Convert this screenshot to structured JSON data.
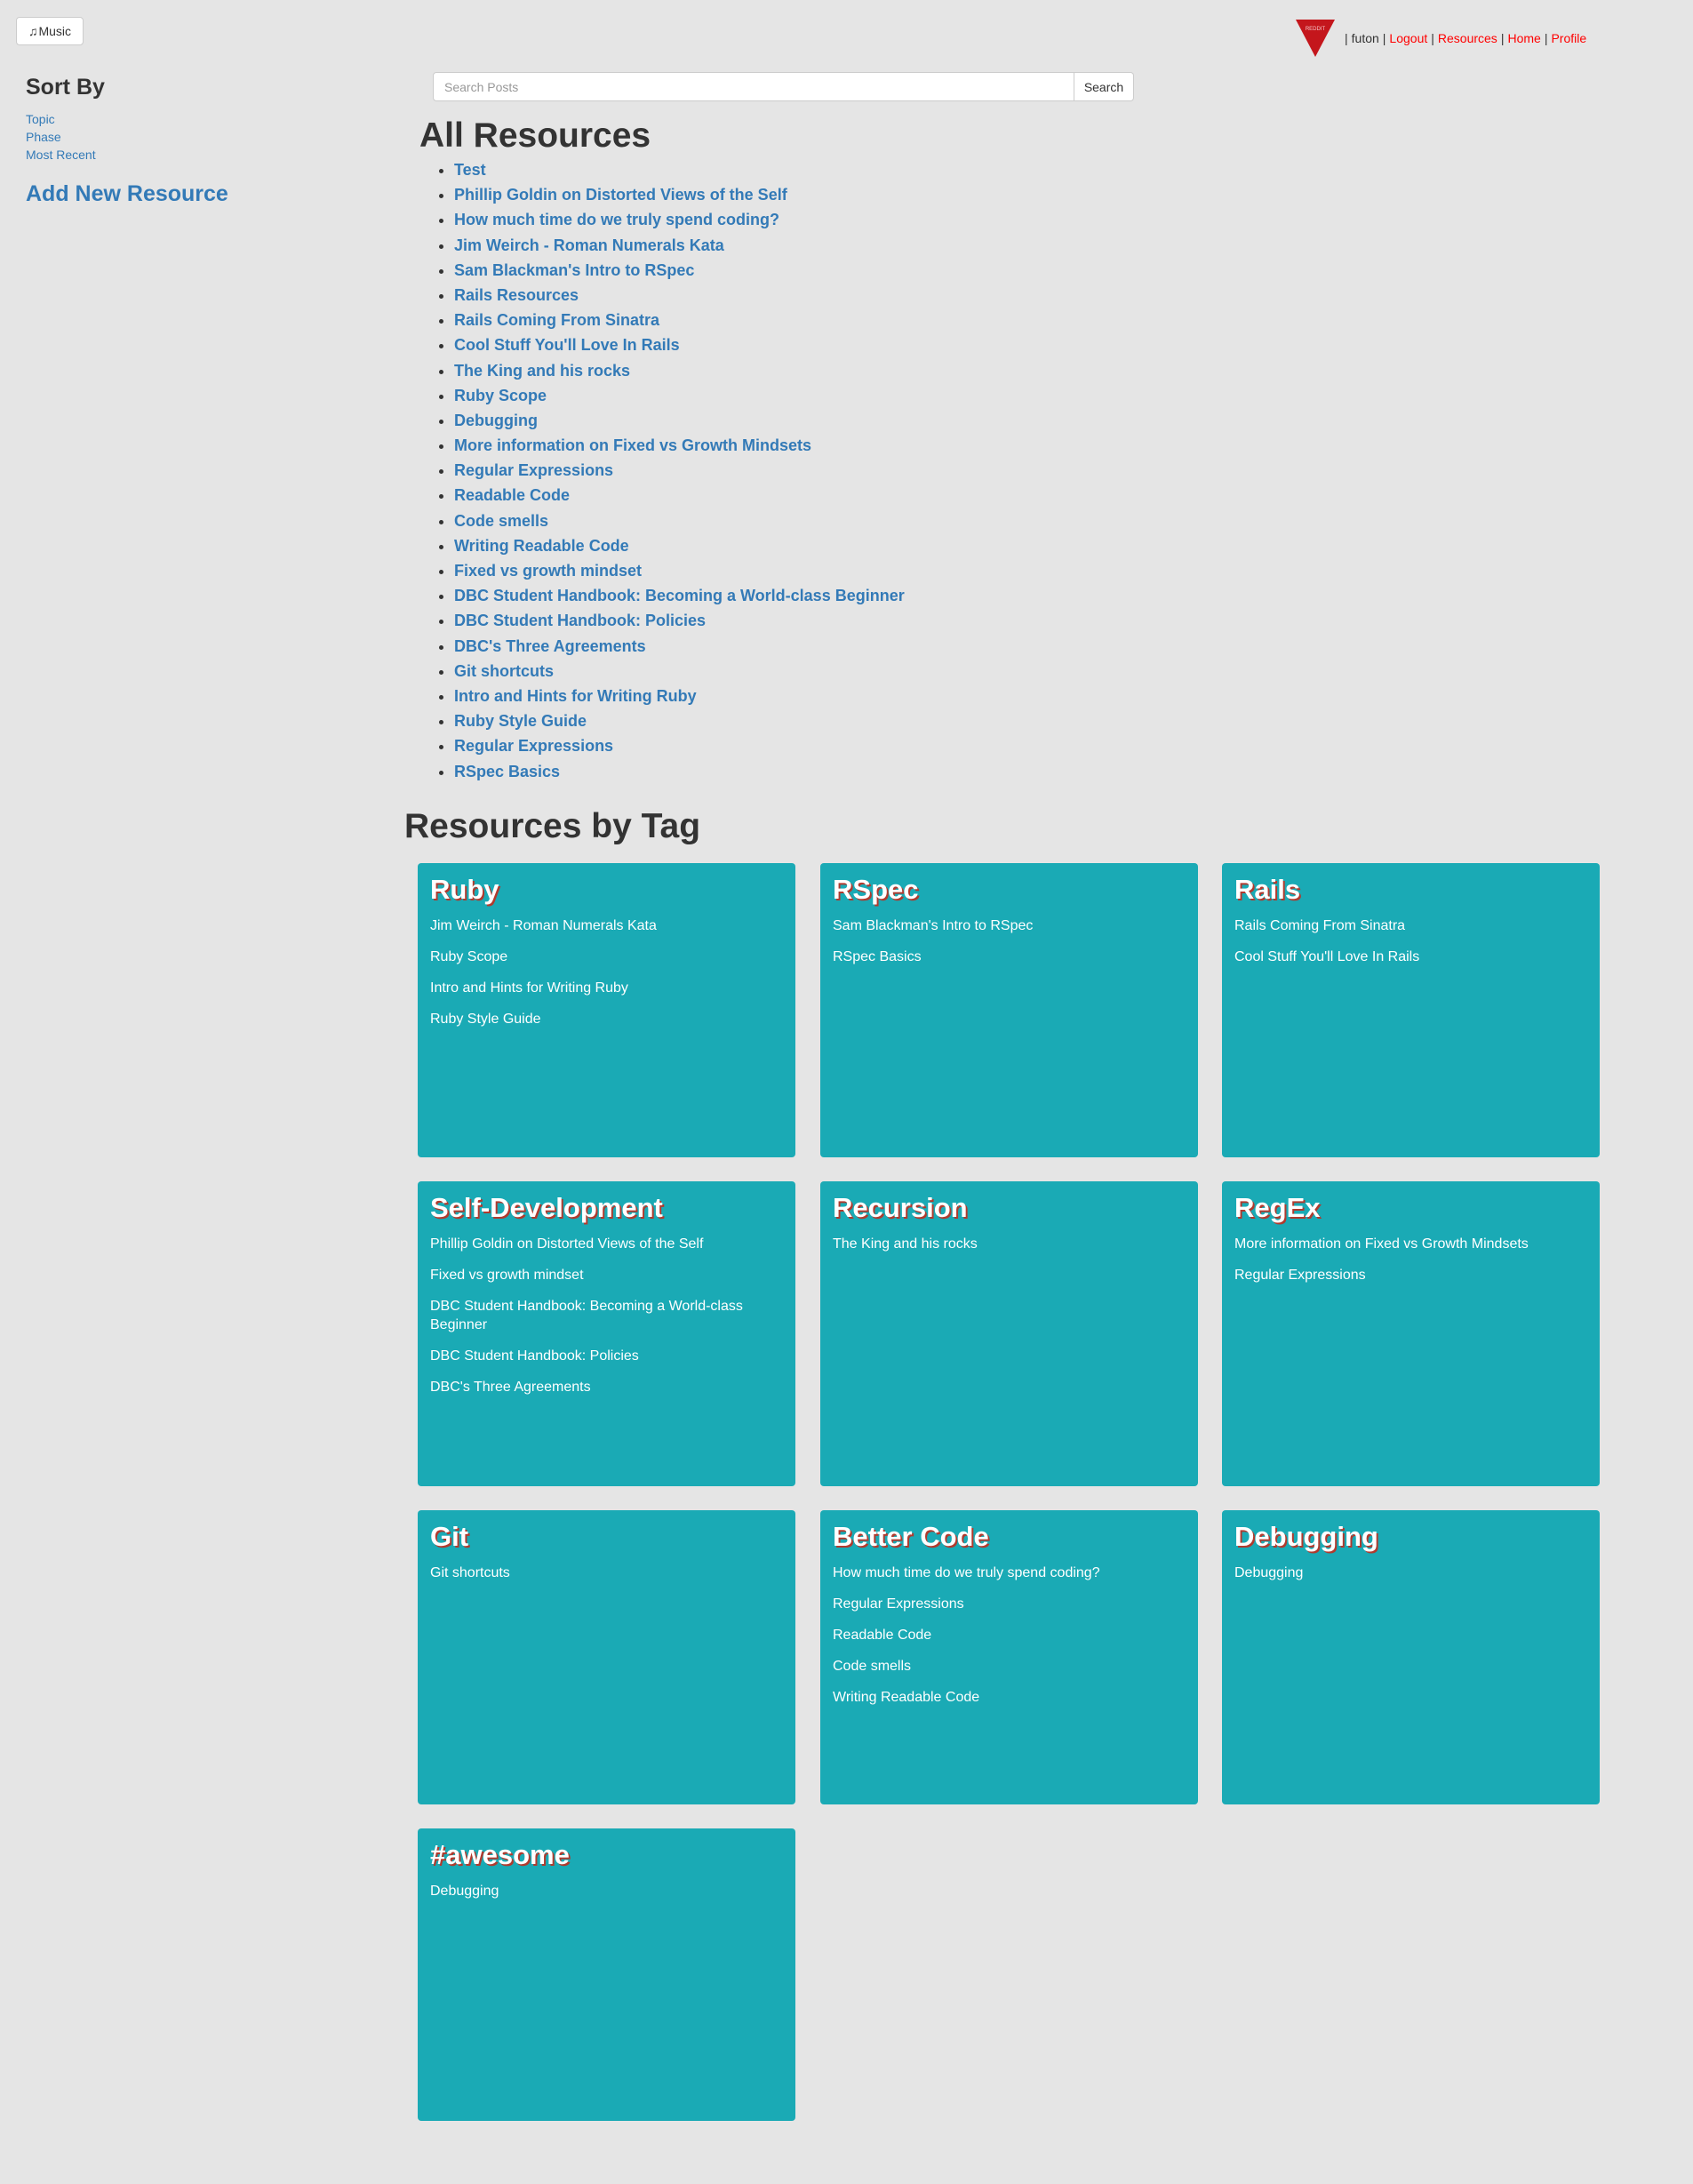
{
  "music_button": {
    "icon": "music-note-icon",
    "label": "Music"
  },
  "topnav": {
    "logo_text": "REDDIT",
    "separator": "|",
    "user": "futon",
    "links": [
      "Logout",
      "Resources",
      "Home",
      "Profile"
    ],
    "link_color": "#ff0000"
  },
  "sidebar": {
    "title": "Sort By",
    "sort_options": [
      "Topic",
      "Phase",
      "Most Recent"
    ],
    "add_resource": "Add New Resource"
  },
  "search": {
    "placeholder": "Search Posts",
    "value": "",
    "button_label": "Search"
  },
  "all_resources": {
    "title": "All Resources",
    "items": [
      "Test",
      "Phillip Goldin on Distorted Views of the Self",
      "How much time do we truly spend coding?",
      "Jim Weirch - Roman Numerals Kata",
      "Sam Blackman's Intro to RSpec",
      "Rails Resources",
      "Rails Coming From Sinatra",
      "Cool Stuff You'll Love In Rails",
      "The King and his rocks",
      "Ruby Scope",
      "Debugging",
      "More information on Fixed vs Growth Mindsets",
      "Regular Expressions",
      "Readable Code",
      "Code smells",
      "Writing Readable Code",
      "Fixed vs growth mindset",
      "DBC Student Handbook: Becoming a World-class Beginner",
      "DBC Student Handbook: Policies",
      "DBC's Three Agreements",
      "Git shortcuts",
      "Intro and Hints for Writing Ruby",
      "Ruby Style Guide",
      "Regular Expressions",
      "RSpec Basics"
    ]
  },
  "resources_by_tag": {
    "title": "Resources by Tag",
    "card_color": "#1aaab5",
    "tags": [
      {
        "name": "Ruby",
        "items": [
          "Jim Weirch - Roman Numerals Kata",
          "Ruby Scope",
          "Intro and Hints for Writing Ruby",
          "Ruby Style Guide"
        ]
      },
      {
        "name": "RSpec",
        "items": [
          "Sam Blackman's Intro to RSpec",
          "RSpec Basics"
        ]
      },
      {
        "name": "Rails",
        "items": [
          "Rails Coming From Sinatra",
          "Cool Stuff You'll Love In Rails"
        ]
      },
      {
        "name": "Self-Development",
        "items": [
          "Phillip Goldin on Distorted Views of the Self",
          "Fixed vs growth mindset",
          "DBC Student Handbook: Becoming a World-class Beginner",
          "DBC Student Handbook: Policies",
          "DBC's Three Agreements"
        ]
      },
      {
        "name": "Recursion",
        "items": [
          "The King and his rocks"
        ]
      },
      {
        "name": "RegEx",
        "items": [
          "More information on Fixed vs Growth Mindsets",
          "Regular Expressions"
        ]
      },
      {
        "name": "Git",
        "items": [
          "Git shortcuts"
        ]
      },
      {
        "name": "Better Code",
        "items": [
          "How much time do we truly spend coding?",
          "Regular Expressions",
          "Readable Code",
          "Code smells",
          "Writing Readable Code"
        ]
      },
      {
        "name": "Debugging",
        "items": [
          "Debugging"
        ]
      },
      {
        "name": "#awesome",
        "items": [
          "Debugging"
        ]
      }
    ]
  }
}
